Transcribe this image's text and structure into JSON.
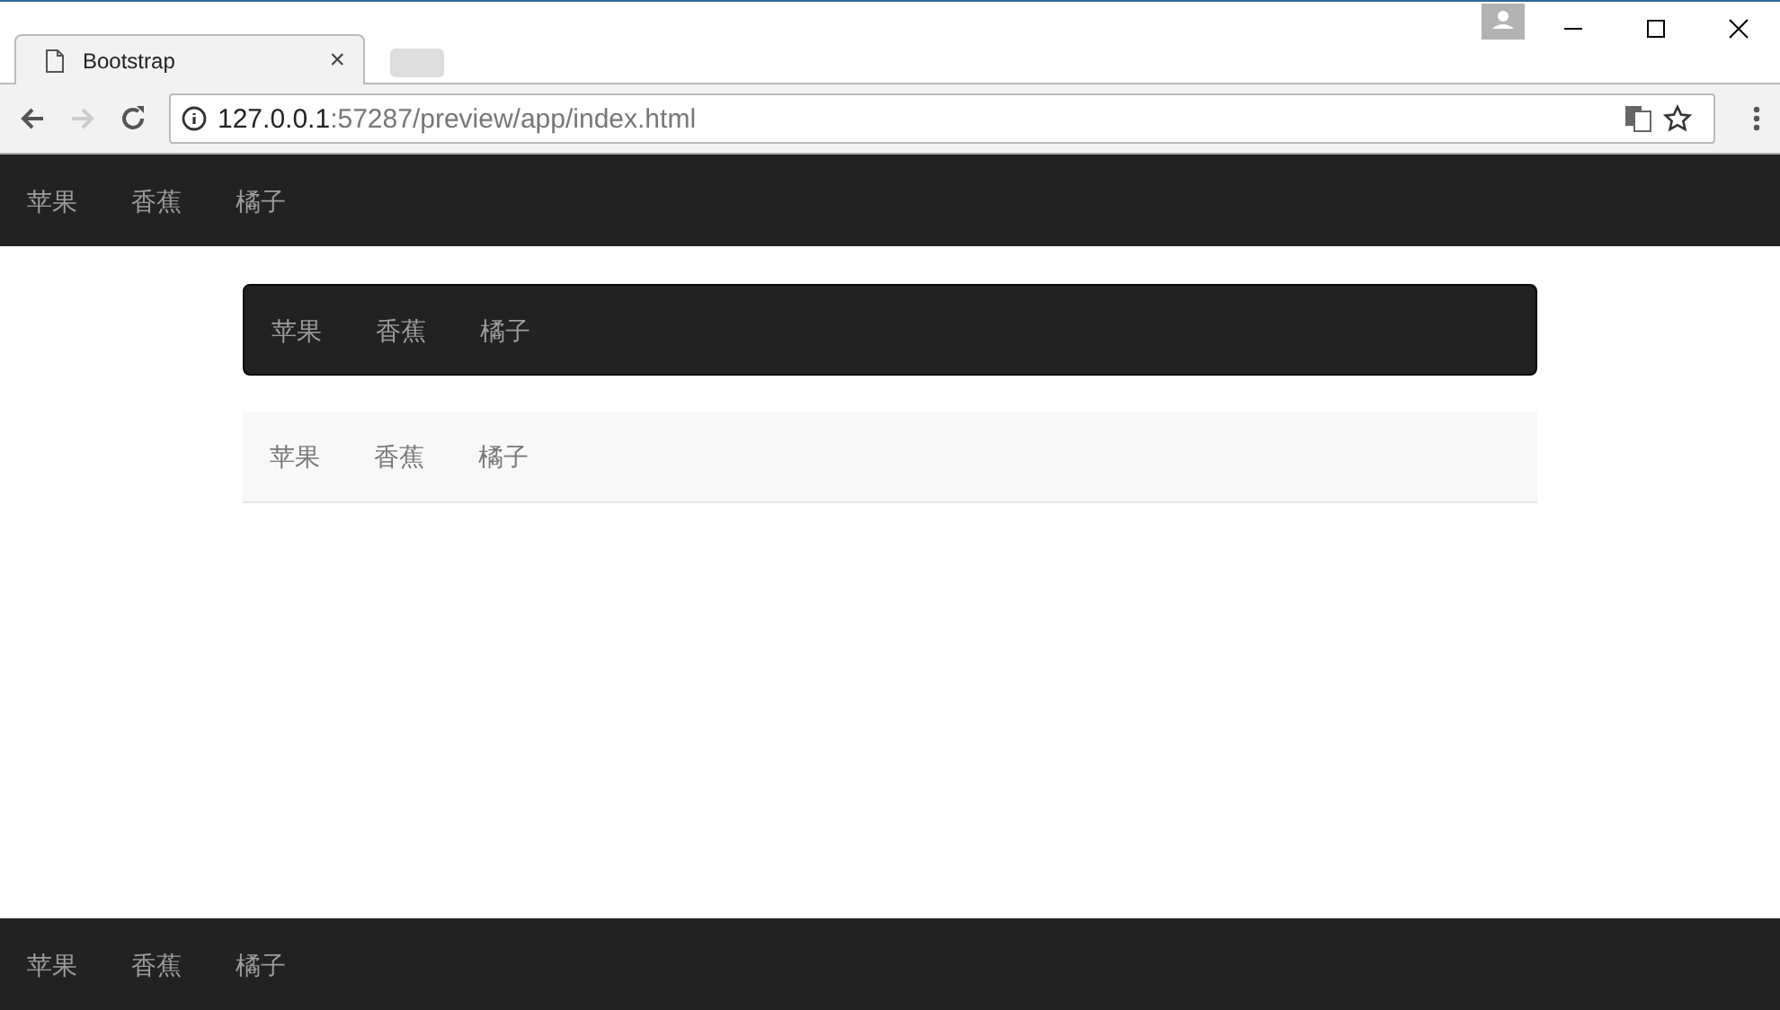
{
  "browser": {
    "tab": {
      "title": "Bootstrap",
      "close": "×"
    },
    "address": {
      "host": "127.0.0.1",
      "path": ":57287/preview/app/index.html"
    }
  },
  "navbars": [
    {
      "kind": "inverse-top",
      "items": [
        "苹果",
        "香蕉",
        "橘子"
      ]
    },
    {
      "kind": "inverse",
      "items": [
        "苹果",
        "香蕉",
        "橘子"
      ]
    },
    {
      "kind": "default",
      "items": [
        "苹果",
        "香蕉",
        "橘子"
      ]
    },
    {
      "kind": "inverse-bottom",
      "items": [
        "苹果",
        "香蕉",
        "橘子"
      ]
    }
  ]
}
